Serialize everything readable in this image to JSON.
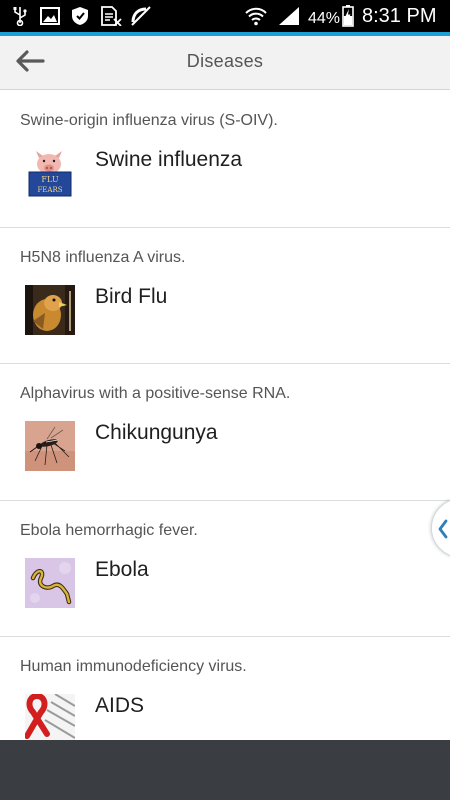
{
  "status_bar": {
    "battery_percent": "44%",
    "time": "8:31 PM",
    "icons": [
      "usb-icon",
      "image-icon",
      "shield-icon",
      "sim-card-icon",
      "no-call-icon",
      "wifi-icon",
      "signal-icon",
      "battery-charging-icon"
    ]
  },
  "header": {
    "back_icon": "arrow-left-icon",
    "title": "Diseases"
  },
  "diseases": [
    {
      "description": "Swine-origin influenza virus (S-OIV).",
      "name": "Swine influenza",
      "thumb": "pig-thumbnail"
    },
    {
      "description": "H5N8 influenza A virus.",
      "name": "Bird Flu",
      "thumb": "bird-thumbnail"
    },
    {
      "description": "Alphavirus with a positive-sense RNA.",
      "name": "Chikungunya",
      "thumb": "mosquito-thumbnail"
    },
    {
      "description": "Ebola hemorrhagic fever.",
      "name": "Ebola",
      "thumb": "virus-thumbnail"
    },
    {
      "description": "Human immunodeficiency virus.",
      "name": "AIDS",
      "thumb": "ribbon-thumbnail"
    }
  ],
  "colors": {
    "status_accent": "#1a9fd8",
    "app_bar_bg": "#f2f2f2",
    "bottom_bar": "#3a3d42",
    "handle_chevron": "#2f7fb8"
  }
}
